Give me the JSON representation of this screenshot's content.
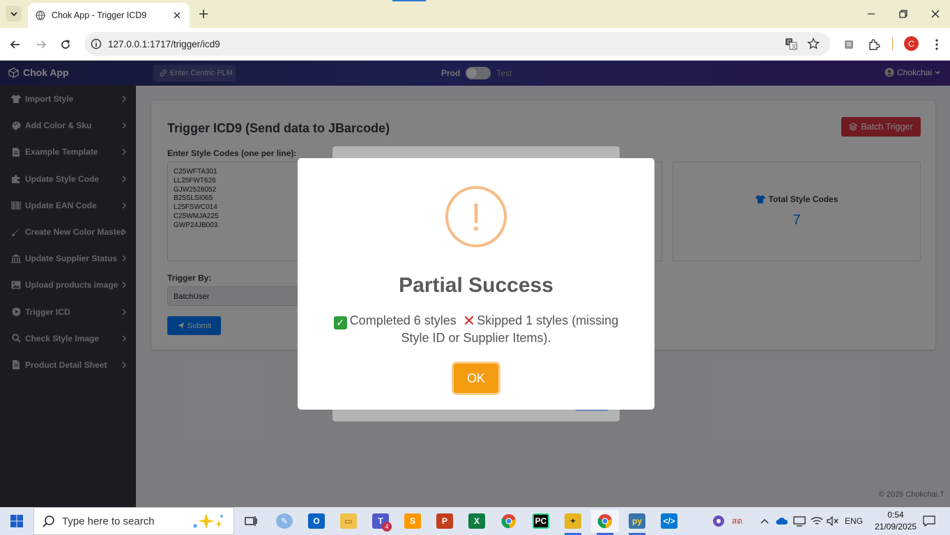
{
  "browser": {
    "tab_title": "Chok App - Trigger ICD9",
    "url": "127.0.0.1:1717/trigger/icd9",
    "profile_initial": "C"
  },
  "app": {
    "brand": "Chok App",
    "plm_placeholder": "Enter Centric PLM",
    "env_prod": "Prod",
    "env_test": "Test",
    "user": "Chokchai",
    "footer": "© 2025 Chokchai.T"
  },
  "sidebar": {
    "items": [
      {
        "label": "Import Style",
        "icon": "shirt-icon"
      },
      {
        "label": "Add Color & Sku",
        "icon": "palette-icon"
      },
      {
        "label": "Example Template",
        "icon": "file-icon"
      },
      {
        "label": "Update Style Code",
        "icon": "puzzle-icon"
      },
      {
        "label": "Update EAN Code",
        "icon": "barcode-icon"
      },
      {
        "label": "Create New Color Master",
        "icon": "brush-icon"
      },
      {
        "label": "Update Supplier Status",
        "icon": "bank-icon"
      },
      {
        "label": "Upload products image",
        "icon": "image-icon"
      },
      {
        "label": "Trigger ICD",
        "icon": "play-icon"
      },
      {
        "label": "Check Style Image",
        "icon": "search-icon"
      },
      {
        "label": "Product Detail Sheet",
        "icon": "file-icon"
      }
    ]
  },
  "main": {
    "title": "Trigger ICD9 (Send data to JBarcode)",
    "batch_button": "Batch Trigger",
    "codes_label": "Enter Style Codes (one per line):",
    "codes": [
      "C25WFTA301",
      "LL25FWT626",
      "GJW2528052",
      "B25SLSI065",
      "L25FSWC014",
      "C25WMJA225",
      "GWP24JB003"
    ],
    "trigger_by_label": "Trigger By:",
    "trigger_by_value": "BatchUser",
    "submit": "Submit",
    "total_label": "Total Style Codes",
    "total_value": "7"
  },
  "dialog": {
    "icon": "!",
    "title": "Partial Success",
    "completed": "Completed 6 styles",
    "skipped": "Skipped 1 styles (missing Style ID or Supplier Items).",
    "ok": "OK"
  },
  "taskbar": {
    "search_placeholder": "Type here to search",
    "teams_badge": "4",
    "lang": "ENG",
    "thai": "สด",
    "time": "0:54",
    "date": "21/09/2025"
  }
}
